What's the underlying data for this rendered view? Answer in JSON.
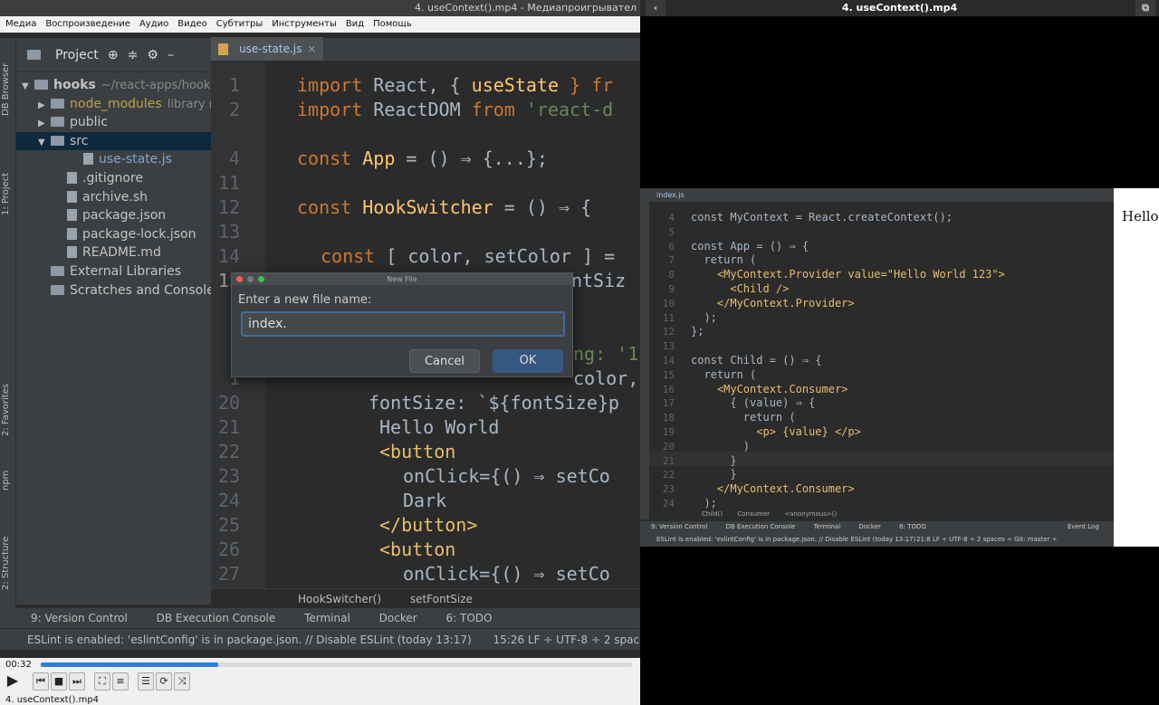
{
  "left_player": {
    "window_title": "4. useContext().mp4 - Медиапроигрывател",
    "menu": [
      "Медиа",
      "Воспроизведение",
      "Аудио",
      "Видео",
      "Субтитры",
      "Инструменты",
      "Вид",
      "Помощь"
    ],
    "time": "00:32",
    "progress_fraction": 0.3,
    "filename": "4. useContext().mp4"
  },
  "ide": {
    "side_tabs": [
      "DB Browser",
      "1: Project",
      "2: Favorites",
      "npm",
      "2: Structure"
    ],
    "project_title": "Project",
    "tree": [
      {
        "label": "hooks",
        "extra": "~/react-apps/hook",
        "kind": "folder",
        "indent": 0,
        "arrow": "▼"
      },
      {
        "label": "node_modules",
        "extra": "library r",
        "kind": "folder",
        "indent": 1,
        "arrow": "▶"
      },
      {
        "label": "public",
        "extra": "",
        "kind": "folder",
        "indent": 1,
        "arrow": "▶"
      },
      {
        "label": "src",
        "extra": "",
        "kind": "folder",
        "indent": 1,
        "arrow": "▼"
      },
      {
        "label": "use-state.js",
        "extra": "",
        "kind": "file",
        "indent": 3,
        "arrow": ""
      },
      {
        "label": ".gitignore",
        "extra": "",
        "kind": "file",
        "indent": 2,
        "arrow": ""
      },
      {
        "label": "archive.sh",
        "extra": "",
        "kind": "file",
        "indent": 2,
        "arrow": ""
      },
      {
        "label": "package.json",
        "extra": "",
        "kind": "file",
        "indent": 2,
        "arrow": ""
      },
      {
        "label": "package-lock.json",
        "extra": "",
        "kind": "file",
        "indent": 2,
        "arrow": ""
      },
      {
        "label": "README.md",
        "extra": "",
        "kind": "file",
        "indent": 2,
        "arrow": ""
      },
      {
        "label": "External Libraries",
        "extra": "",
        "kind": "folder",
        "indent": 1,
        "arrow": ""
      },
      {
        "label": "Scratches and Consoles",
        "extra": "",
        "kind": "folder",
        "indent": 1,
        "arrow": ""
      }
    ],
    "tab": "use-state.js",
    "line_numbers": [
      "1",
      "2",
      "4",
      "11",
      "12",
      "13",
      "14",
      "15",
      "",
      "",
      "1",
      "1",
      "20",
      "21",
      "22",
      "23",
      "24",
      "25",
      "26",
      "27"
    ],
    "code": {
      "l1a": "import",
      "l1b": " React, { ",
      "l1c": "useState",
      "l1d": " } fr",
      "l2a": "import",
      "l2b": " ReactDOM ",
      "l2c": "from",
      "l2d": " 'react-d",
      "l4a": "const",
      "l4b": " App",
      "l4c": " = () ⇒ {...};",
      "l12a": "const",
      "l12b": " HookSwitcher",
      "l12c": " = () ⇒ {",
      "l14a": "const",
      "l14b": " [ color, setColor ] =",
      "l15": "const [ fontSize, setFontSiz",
      "l18": "ng: '1",
      "l19": "color,",
      "l20": "fontSize: `${fontSize}p",
      "l21": "Hello World",
      "l22": "<button",
      "l23": "onClick={() ⇒ setCo",
      "l24": "Dark",
      "l25": "</button>",
      "l26": "<button",
      "l27": "onClick={() ⇒ setCo"
    },
    "breadcrumbs": [
      "HookSwitcher()",
      "setFontSize"
    ],
    "tool_windows": [
      "9: Version Control",
      "DB Execution Console",
      "Terminal",
      "Docker",
      "6: TODO"
    ],
    "status": "ESLint is enabled: 'eslintConfig' is in package.json. // Disable ESLint (today 13:17)",
    "status_right": "15:26   LF ÷   UTF-8 ÷   2 spaces"
  },
  "dialog": {
    "title": "New File",
    "label": "Enter a new file name:",
    "value": "index.",
    "cancel": "Cancel",
    "ok": "OK"
  },
  "right_player": {
    "title": "4. useContext().mp4",
    "tab": "index.js",
    "line_numbers": [
      "4",
      "5",
      "6",
      "7",
      "8",
      "9",
      "10",
      "11",
      "12",
      "13",
      "14",
      "15",
      "16",
      "17",
      "18",
      "19",
      "20",
      "21",
      "22",
      "23",
      "24"
    ],
    "code_lines": [
      "const MyContext = React.createContext();",
      "",
      "const App = () ⇒ {",
      "  return (",
      "    <MyContext.Provider value=\"Hello World 123\">",
      "      <Child />",
      "    </MyContext.Provider>",
      "  );",
      "};",
      "",
      "const Child = () ⇒ {",
      "  return (",
      "    <MyContext.Consumer>",
      "      { (value) ⇒ {",
      "        return (",
      "          <p> {value} </p>",
      "        )",
      "      }",
      "      }",
      "    </MyContext.Consumer>",
      "  );"
    ],
    "breadcrumbs": [
      "Child()",
      "Consumer",
      "<anonymous>()"
    ],
    "tool_windows": [
      "9: Version Control",
      "DB Execution Console",
      "Terminal",
      "Docker",
      "6: TODO"
    ],
    "event_log": "Event Log",
    "status": "ESLint is enabled: 'eslintConfig' is in package.json. // Disable ESLint (today 13:17)",
    "status_right": "21:8  LF ÷  UTF-8 ÷  2 spaces ÷  Git: master ÷",
    "browser_text": "Hello"
  }
}
